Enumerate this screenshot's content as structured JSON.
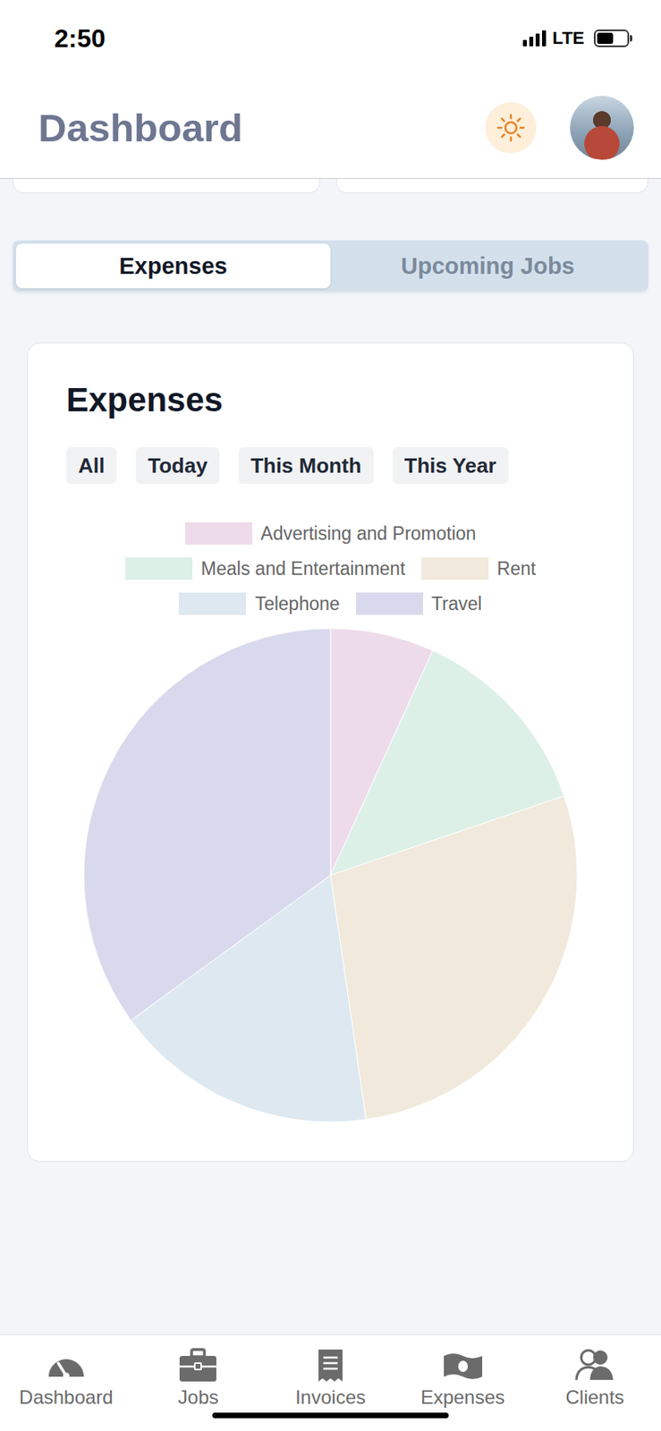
{
  "status_bar": {
    "time": "2:50",
    "network": "LTE",
    "signal": {
      "level": 1
    },
    "battery": {
      "level": 0.55
    }
  },
  "header": {
    "title": "Dashboard"
  },
  "segment_tabs": [
    {
      "label": "Expenses",
      "selected": true
    },
    {
      "label": "Upcoming Jobs",
      "selected": false
    }
  ],
  "expenses_card": {
    "title": "Expenses",
    "filters": [
      {
        "label": "All",
        "selected": false
      },
      {
        "label": "Today",
        "selected": false
      },
      {
        "label": "This Month",
        "selected": false
      },
      {
        "label": "This Year",
        "selected": false
      }
    ],
    "chart": {
      "kind": "pie",
      "series": [
        {
          "label": "Advertising and Promotion",
          "value": 340,
          "color": "#eedbea"
        },
        {
          "label": "Meals and Entertainment",
          "value": 650,
          "color": "#dcf0e8"
        },
        {
          "label": "Rent",
          "value": 1395,
          "color": "#f1e9db"
        },
        {
          "label": "Telephone",
          "value": 865,
          "color": "#dde8f0"
        },
        {
          "label": "Travel",
          "value": 1750,
          "color": "#d9d9ee"
        }
      ]
    }
  },
  "bottom_nav": [
    {
      "label": "Dashboard",
      "selected": false
    },
    {
      "label": "Jobs",
      "selected": false
    },
    {
      "label": "Invoices",
      "selected": false
    },
    {
      "label": "Expenses",
      "selected": false
    },
    {
      "label": "Clients",
      "selected": false
    }
  ]
}
